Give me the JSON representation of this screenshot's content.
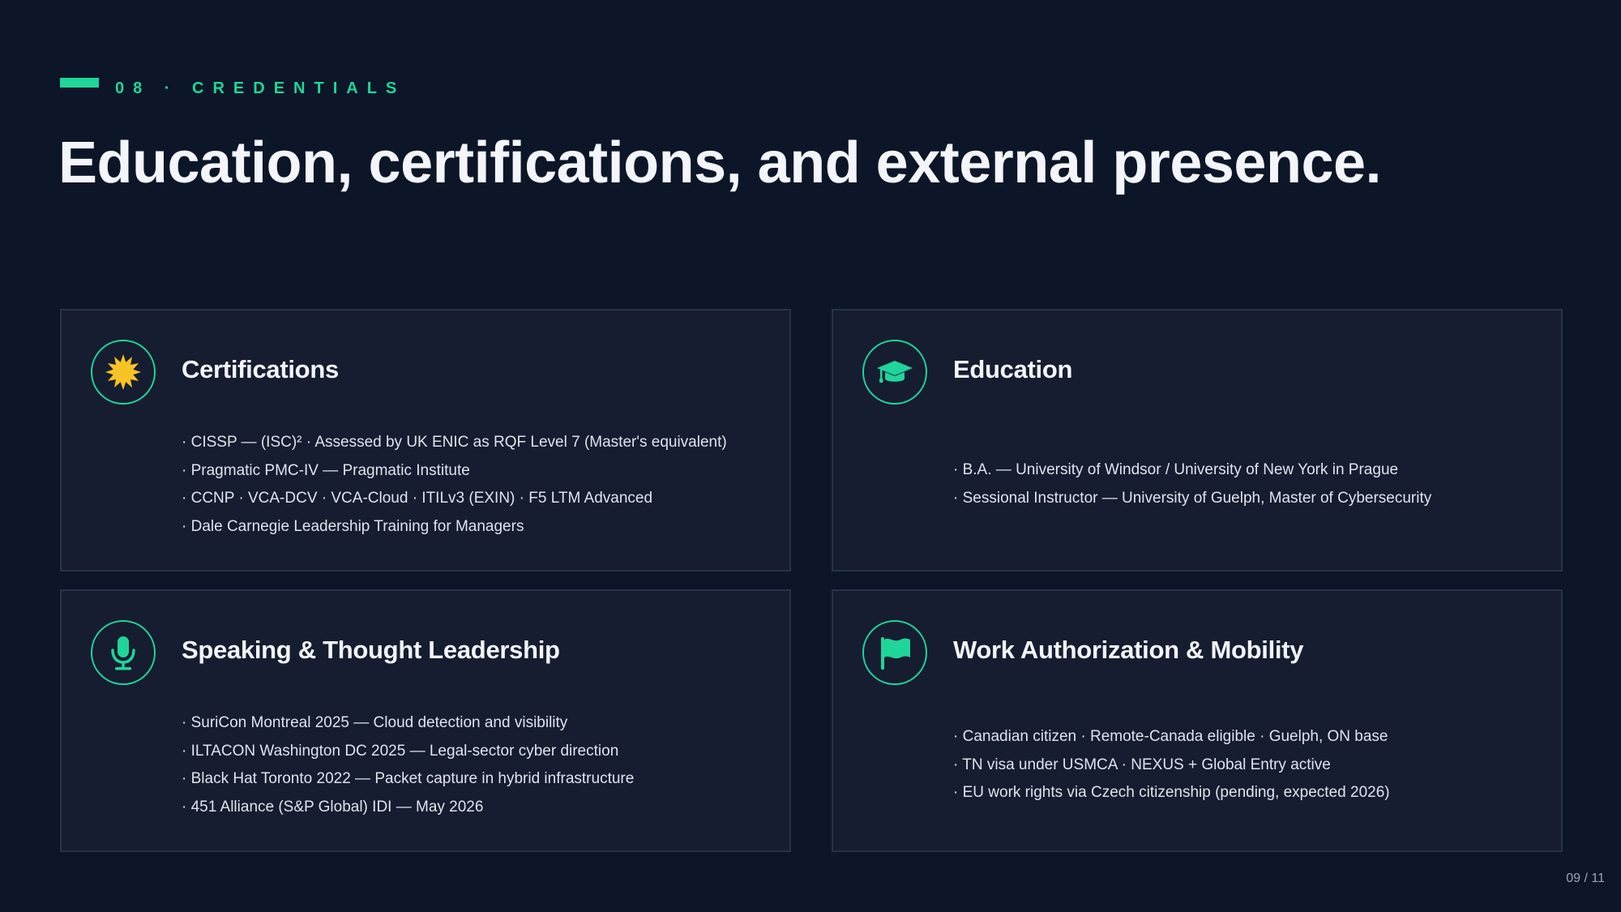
{
  "slide": {
    "kicker": "08 · CREDENTIALS",
    "title": "Education, certifications, and external presence.",
    "page_number": "09 / 11"
  },
  "colors": {
    "background": "#0d1628",
    "card_background": "#161d30",
    "accent": "#1fd59a",
    "badge_yellow": "#f6c326"
  },
  "cards": [
    {
      "title": "Certifications",
      "icon": "badge-icon",
      "items": [
        "· CISSP — (ISC)² · Assessed by UK ENIC as RQF Level 7 (Master's equivalent)",
        "· Pragmatic PMC-IV — Pragmatic Institute",
        "· CCNP · VCA-DCV · VCA-Cloud · ITILv3 (EXIN) · F5 LTM Advanced",
        "· Dale Carnegie Leadership Training for Managers"
      ]
    },
    {
      "title": "Education",
      "icon": "graduation-cap-icon",
      "items": [
        "· B.A. — University of Windsor / University of New York in Prague",
        "· Sessional Instructor — University of Guelph, Master of Cybersecurity"
      ]
    },
    {
      "title": "Speaking & Thought Leadership",
      "icon": "microphone-icon",
      "items": [
        "· SuriCon Montreal 2025 — Cloud detection and visibility",
        "· ILTACON Washington DC 2025 — Legal-sector cyber direction",
        "· Black Hat Toronto 2022 — Packet capture in hybrid infrastructure",
        "· 451 Alliance (S&P Global) IDI — May 2026"
      ]
    },
    {
      "title": "Work Authorization & Mobility",
      "icon": "flag-icon",
      "items": [
        "· Canadian citizen · Remote-Canada eligible · Guelph, ON base",
        "· TN visa under USMCA · NEXUS + Global Entry active",
        "· EU work rights via Czech citizenship (pending, expected 2026)"
      ]
    }
  ]
}
